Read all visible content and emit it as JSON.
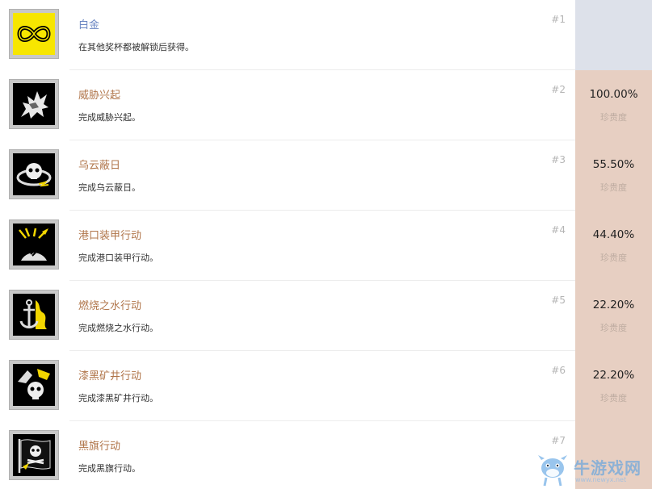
{
  "colors": {
    "platinum_stat_bg": "#dde1ea",
    "trophy_stat_bg": "#e7cfc2",
    "platinum_title": "#6b86c2",
    "trophy_title": "#b0754a",
    "icon_frame": "#c8c8c8",
    "platinum_icon_bg": "#f7e600"
  },
  "trophies": [
    {
      "title": "白金",
      "desc": "在其他奖杯都被解锁后获得。",
      "num": "#1",
      "percent": "",
      "rarity": "",
      "icon": "infinity-icon",
      "tier": "platinum"
    },
    {
      "title": "威胁兴起",
      "desc": "完成威胁兴起。",
      "num": "#2",
      "percent": "100.00%",
      "rarity": "珍贵度",
      "icon": "gargoyle-icon",
      "tier": "trophy"
    },
    {
      "title": "乌云蔽日",
      "desc": "完成乌云蔽日。",
      "num": "#3",
      "percent": "55.50%",
      "rarity": "珍贵度",
      "icon": "skull-storm-icon",
      "tier": "trophy"
    },
    {
      "title": "港口装甲行动",
      "desc": "完成港口装甲行动。",
      "num": "#4",
      "percent": "44.40%",
      "rarity": "珍贵度",
      "icon": "explosion-icon",
      "tier": "trophy"
    },
    {
      "title": "燃烧之水行动",
      "desc": "完成燃烧之水行动。",
      "num": "#5",
      "percent": "22.20%",
      "rarity": "珍贵度",
      "icon": "anchor-fire-icon",
      "tier": "trophy"
    },
    {
      "title": "漆黑矿井行动",
      "desc": "完成漆黑矿井行动。",
      "num": "#6",
      "percent": "22.20%",
      "rarity": "珍贵度",
      "icon": "mine-skull-icon",
      "tier": "trophy"
    },
    {
      "title": "黑旗行动",
      "desc": "完成黑旗行动。",
      "num": "#7",
      "percent": "",
      "rarity": "",
      "icon": "pirate-flag-icon",
      "tier": "trophy"
    }
  ],
  "watermark": {
    "text": "牛游戏网",
    "url": "www.newyx.net"
  }
}
